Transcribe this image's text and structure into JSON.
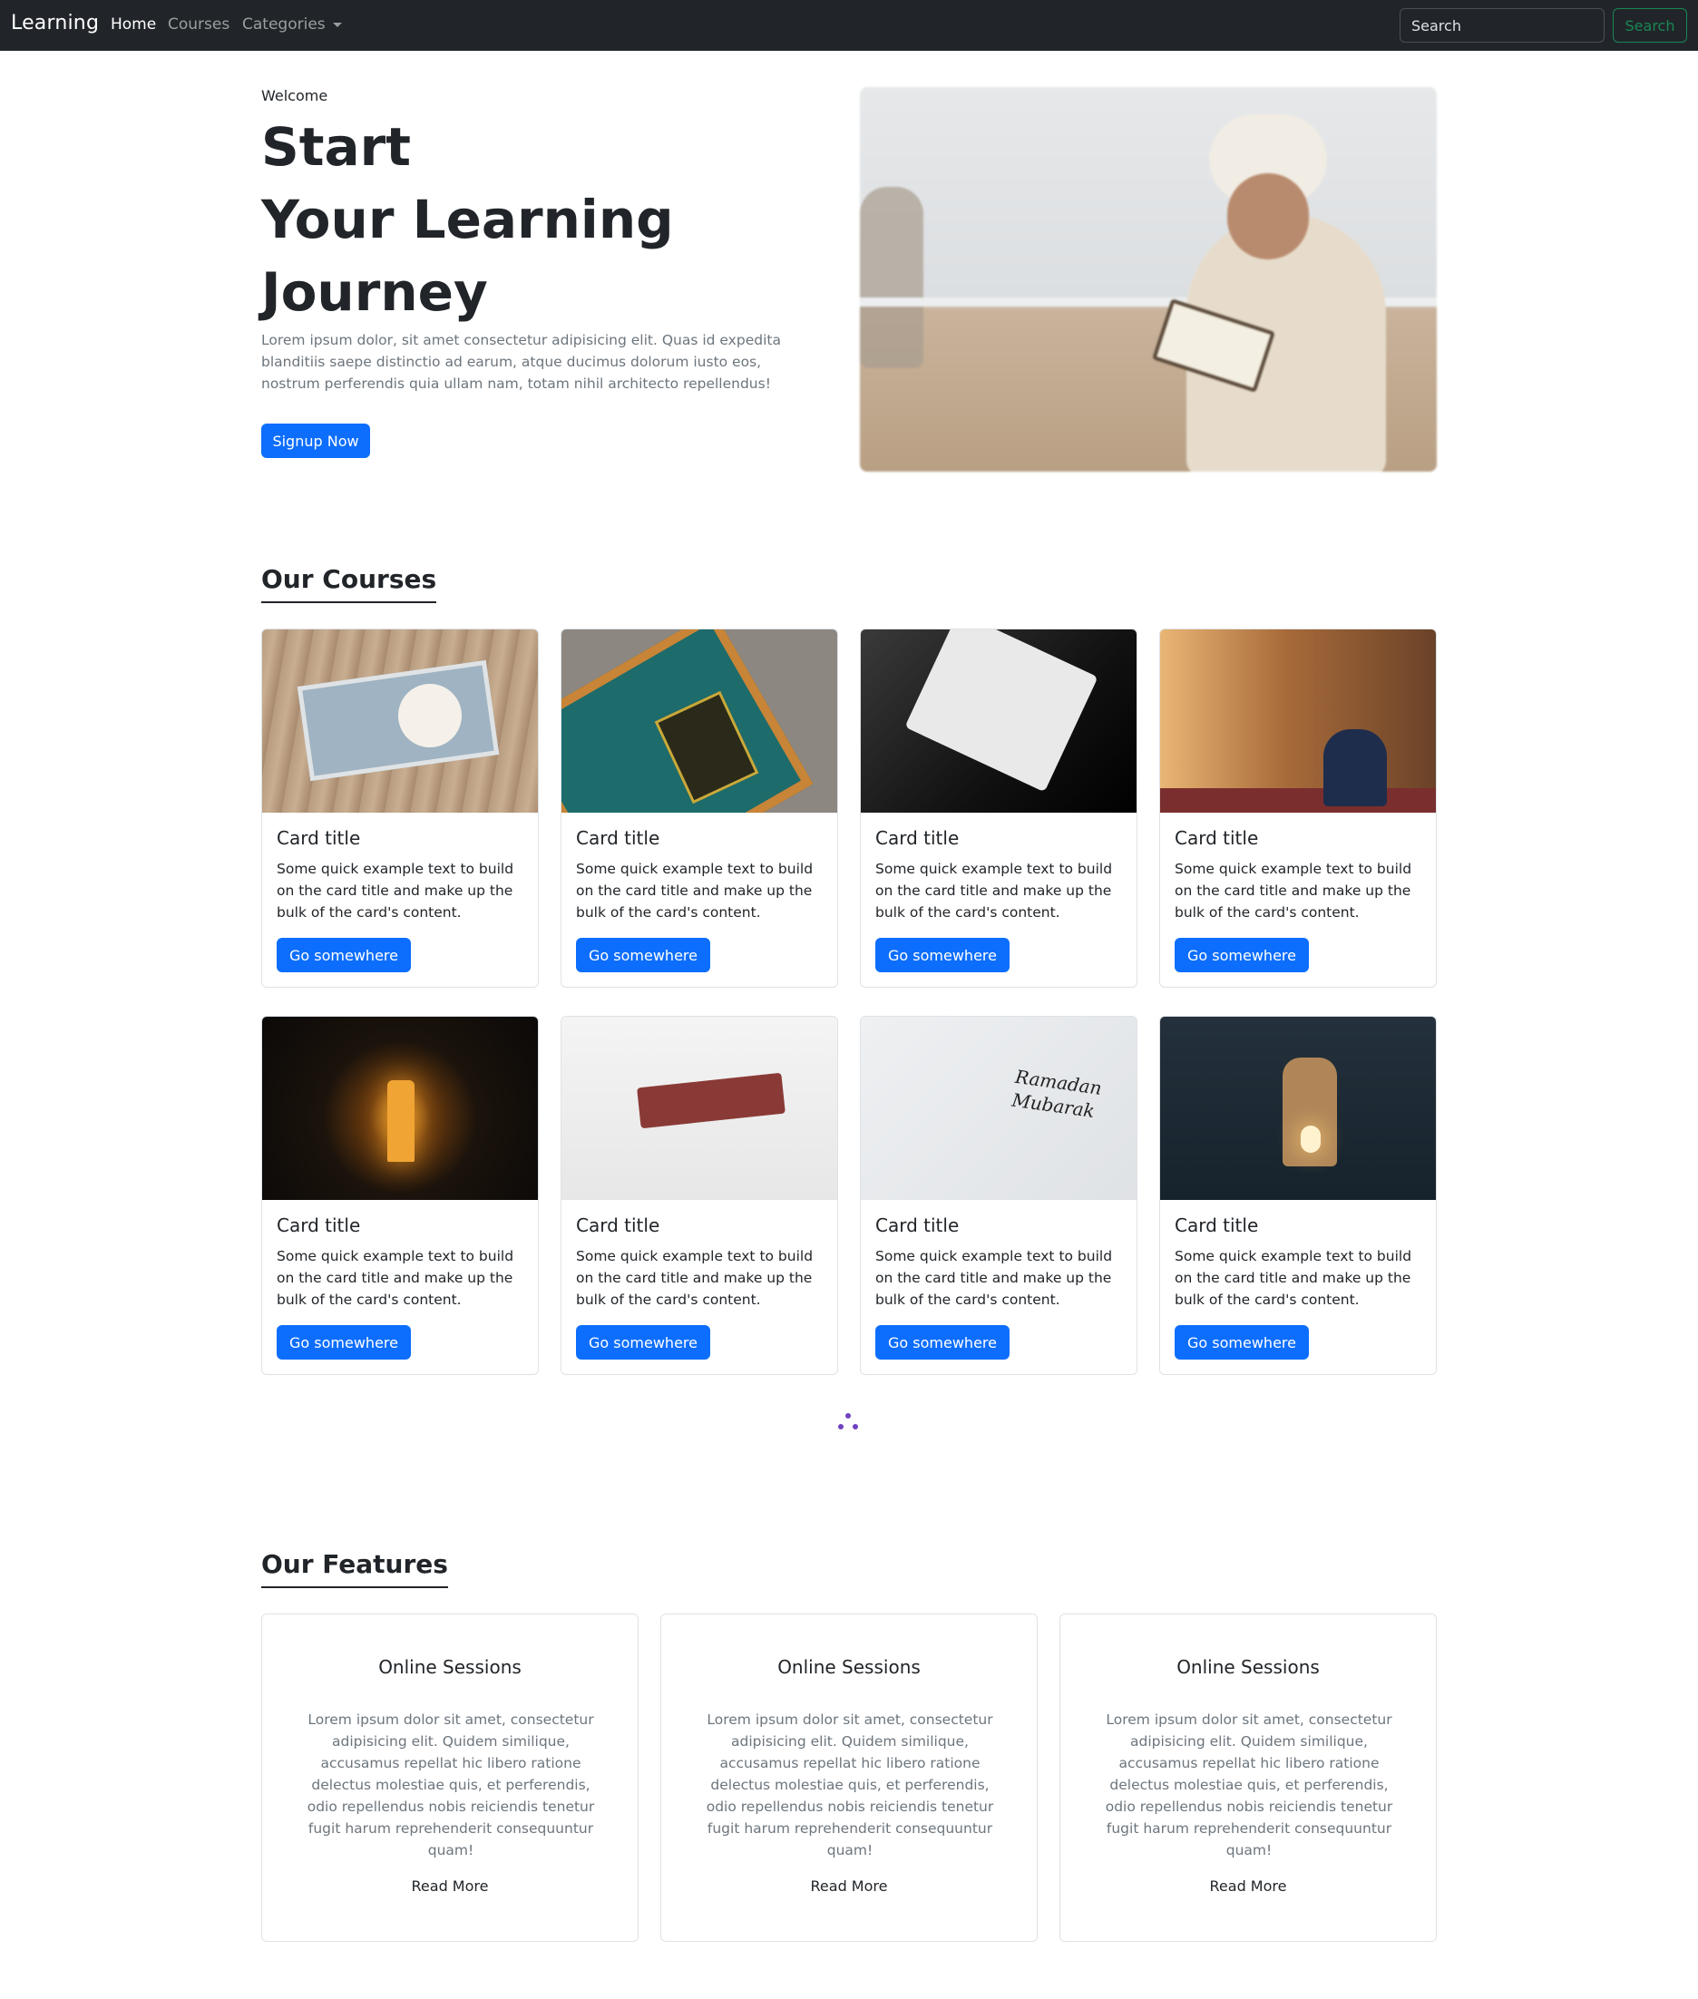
{
  "navbar": {
    "brand": "Learning",
    "links": [
      "Home",
      "Courses",
      "Categories"
    ],
    "search_placeholder": "Search",
    "search_button": "Search"
  },
  "hero": {
    "welcome": "Welcome",
    "title_lines": [
      "Start",
      "Your Learning",
      "Journey"
    ],
    "text": "Lorem ipsum dolor, sit amet consectetur adipisicing elit. Quas id expedita blanditiis saepe distinctio ad earum, atque ducimus dolorum iusto eos, nostrum perferendis quia ullam nam, totam nihil architecto repellendus!",
    "cta": "Signup Now"
  },
  "courses": {
    "heading": "Our Courses",
    "cards": [
      {
        "title": "Card title",
        "text": "Some quick example text to build on the card title and make up the bulk of the card's content.",
        "button": "Go somewhere"
      },
      {
        "title": "Card title",
        "text": "Some quick example text to build on the card title and make up the bulk of the card's content.",
        "button": "Go somewhere"
      },
      {
        "title": "Card title",
        "text": "Some quick example text to build on the card title and make up the bulk of the card's content.",
        "button": "Go somewhere"
      },
      {
        "title": "Card title",
        "text": "Some quick example text to build on the card title and make up the bulk of the card's content.",
        "button": "Go somewhere"
      },
      {
        "title": "Card title",
        "text": "Some quick example text to build on the card title and make up the bulk of the card's content.",
        "button": "Go somewhere"
      },
      {
        "title": "Card title",
        "text": "Some quick example text to build on the card title and make up the bulk of the card's content.",
        "button": "Go somewhere"
      },
      {
        "title": "Card title",
        "text": "Some quick example text to build on the card title and make up the bulk of the card's content.",
        "button": "Go somewhere"
      },
      {
        "title": "Card title",
        "text": "Some quick example text to build on the card title and make up the bulk of the card's content.",
        "button": "Go somewhere"
      }
    ],
    "image_caption_7": "Ramadan Mubarak"
  },
  "features": {
    "heading": "Our Features",
    "items": [
      {
        "title": "Online Sessions",
        "text": "Lorem ipsum dolor sit amet, consectetur adipisicing elit. Quidem similique, accusamus repellat hic libero ratione delectus molestiae quis, et perferendis, odio repellendus nobis reiciendis tenetur fugit harum reprehenderit consequuntur quam!",
        "link": "Read More"
      },
      {
        "title": "Online Sessions",
        "text": "Lorem ipsum dolor sit amet, consectetur adipisicing elit. Quidem similique, accusamus repellat hic libero ratione delectus molestiae quis, et perferendis, odio repellendus nobis reiciendis tenetur fugit harum reprehenderit consequuntur quam!",
        "link": "Read More"
      },
      {
        "title": "Online Sessions",
        "text": "Lorem ipsum dolor sit amet, consectetur adipisicing elit. Quidem similique, accusamus repellat hic libero ratione delectus molestiae quis, et perferendis, odio repellendus nobis reiciendis tenetur fugit harum reprehenderit consequuntur quam!",
        "link": "Read More"
      }
    ]
  },
  "colors": {
    "navbar_bg": "#212529",
    "primary": "#0d6efd",
    "search_outline": "#198754",
    "loader": "#6f42c1",
    "muted_text": "#6c757d"
  },
  "icons": [
    "caret-down-icon",
    "loader-icon"
  ]
}
